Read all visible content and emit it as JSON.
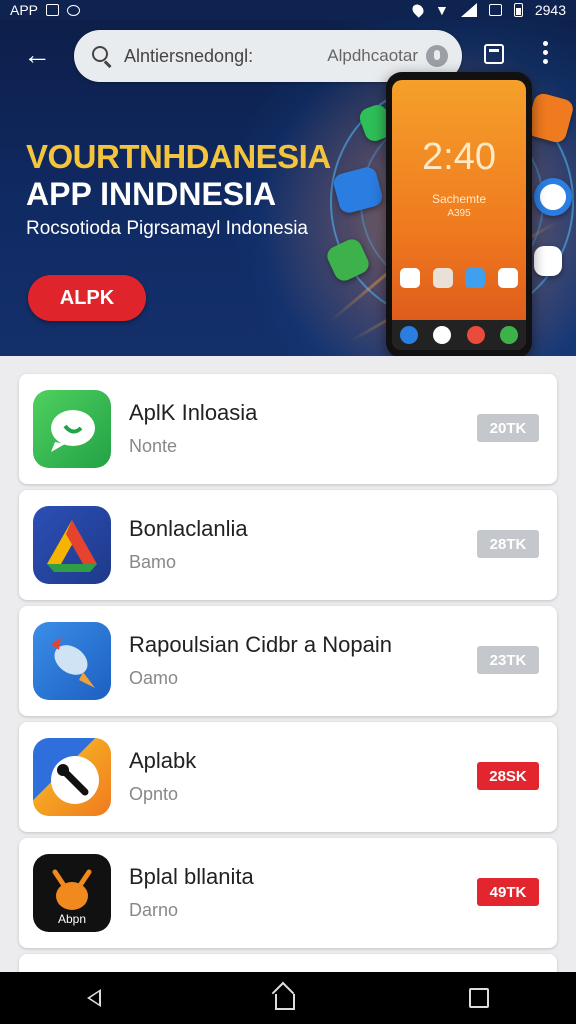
{
  "status_bar": {
    "label": "APP",
    "time": "2943"
  },
  "toolbar": {
    "search_text": "Alntiersnedongl:",
    "search_hint": "Alpdhcaotar"
  },
  "hero": {
    "title_line1": "VOURTNHDANESIA",
    "title_line2": "APP INNDNESIA",
    "subtitle": "Rocsotioda Pigrsamayl Indonesia",
    "button_label": "ALPK",
    "phone_time": "2:40",
    "phone_line1": "Sachemte",
    "phone_line2": "A395"
  },
  "apps": [
    {
      "name": "AplK Inloasia",
      "meta": "Nonte",
      "size": "20TK",
      "badge_color": "#c4c7cb",
      "icon": "chat-bubble-icon"
    },
    {
      "name": "Bonlaclanlia",
      "meta": "Bamo",
      "size": "28TK",
      "badge_color": "#c4c7cb",
      "icon": "triangle-drive-icon"
    },
    {
      "name": "Rapoulsian Cidbr a Nopain",
      "meta": "Oamo",
      "size": "23TK",
      "badge_color": "#c4c7cb",
      "icon": "rocket-icon"
    },
    {
      "name": "Aplabk",
      "meta": "Opnto",
      "size": "28SK",
      "badge_color": "#e3262d",
      "icon": "tools-icon"
    },
    {
      "name": "Bplal bllanita",
      "meta": "Darno",
      "size": "49TK",
      "badge_color": "#e3262d",
      "icon": "deer-icon",
      "icon_text": "Abpn"
    }
  ]
}
